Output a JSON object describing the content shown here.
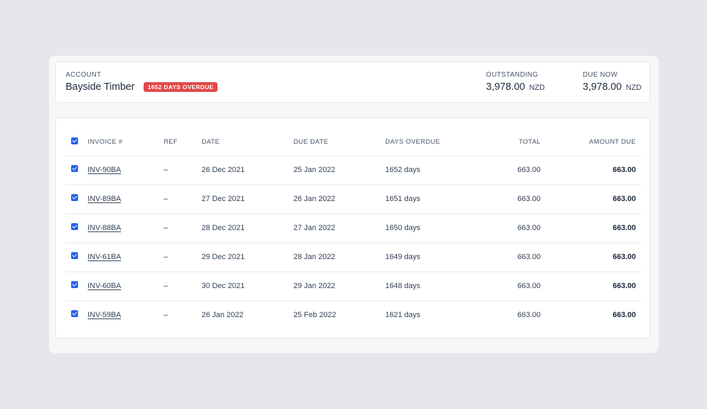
{
  "account": {
    "label": "ACCOUNT",
    "name": "Bayside Timber",
    "badge": "1652 DAYS OVERDUE",
    "outstanding_label": "OUTSTANDING",
    "outstanding_value": "3,978.00",
    "outstanding_currency": "NZD",
    "due_now_label": "DUE NOW",
    "due_now_value": "3,978.00",
    "due_now_currency": "NZD"
  },
  "colors": {
    "badge": "#e04848",
    "checkbox": "#2563eb"
  },
  "table": {
    "headers": {
      "invoice": "INVOICE #",
      "ref": "REF",
      "date": "DATE",
      "due_date": "DUE DATE",
      "days_overdue": "DAYS OVERDUE",
      "total": "TOTAL",
      "amount_due": "AMOUNT DUE"
    },
    "select_all_checked": true,
    "rows": [
      {
        "checked": true,
        "invoice": "INV-90BA",
        "ref": "–",
        "date": "26 Dec 2021",
        "due_date": "25 Jan 2022",
        "days_overdue": "1652 days",
        "total": "663.00",
        "amount_due": "663.00"
      },
      {
        "checked": true,
        "invoice": "INV-89BA",
        "ref": "–",
        "date": "27 Dec 2021",
        "due_date": "26 Jan 2022",
        "days_overdue": "1651 days",
        "total": "663.00",
        "amount_due": "663.00"
      },
      {
        "checked": true,
        "invoice": "INV-88BA",
        "ref": "–",
        "date": "28 Dec 2021",
        "due_date": "27 Jan 2022",
        "days_overdue": "1650 days",
        "total": "663.00",
        "amount_due": "663.00"
      },
      {
        "checked": true,
        "invoice": "INV-61BA",
        "ref": "–",
        "date": "29 Dec 2021",
        "due_date": "28 Jan 2022",
        "days_overdue": "1649 days",
        "total": "663.00",
        "amount_due": "663.00"
      },
      {
        "checked": true,
        "invoice": "INV-60BA",
        "ref": "–",
        "date": "30 Dec 2021",
        "due_date": "29 Jan 2022",
        "days_overdue": "1648 days",
        "total": "663.00",
        "amount_due": "663.00"
      },
      {
        "checked": true,
        "invoice": "INV-59BA",
        "ref": "–",
        "date": "26 Jan 2022",
        "due_date": "25 Feb 2022",
        "days_overdue": "1621 days",
        "total": "663.00",
        "amount_due": "663.00"
      }
    ]
  }
}
